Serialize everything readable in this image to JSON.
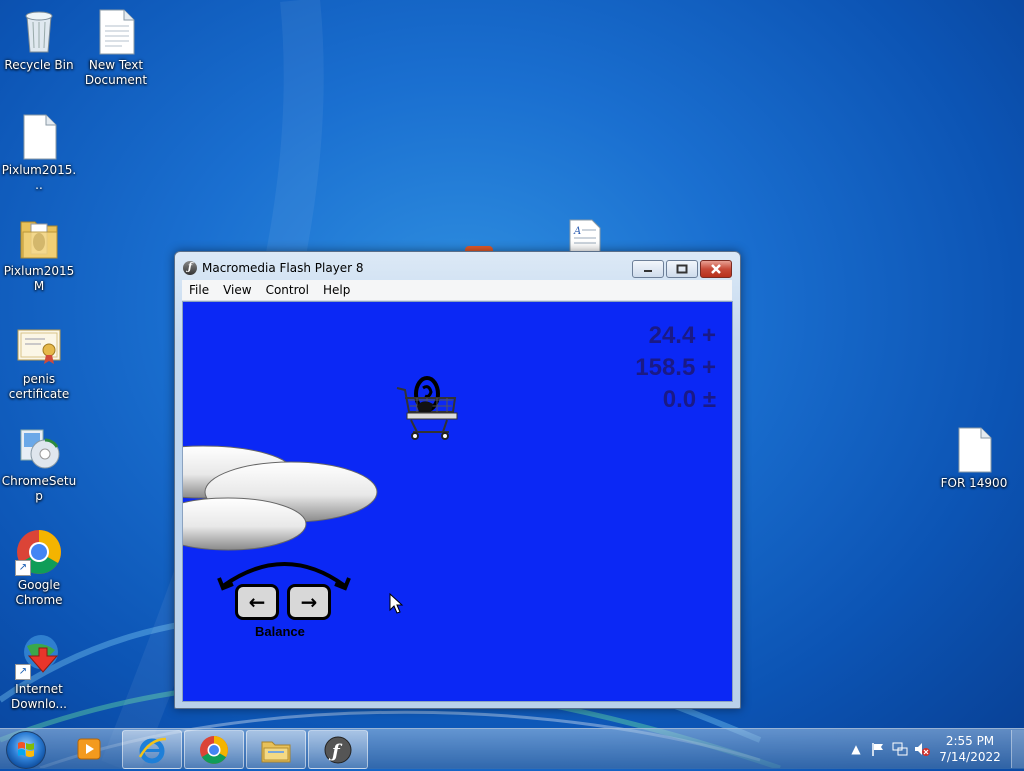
{
  "desktop": {
    "icons": [
      {
        "label": "Recycle Bin",
        "icon": "recycle-bin-icon"
      },
      {
        "label": "New Text Document",
        "icon": "text-document-icon"
      },
      {
        "label": "Pixlum2015...",
        "icon": "blank-file-icon"
      },
      {
        "label": "Pixlum2015M",
        "icon": "folder-icon"
      },
      {
        "label": "penis certificate",
        "icon": "certificate-icon"
      },
      {
        "label": "ChromeSetup",
        "icon": "installer-icon"
      },
      {
        "label": "Google Chrome",
        "icon": "chrome-icon"
      },
      {
        "label": "Internet Downlo...",
        "icon": "idm-icon"
      },
      {
        "label": "FOR 14900",
        "icon": "blank-file-icon"
      }
    ]
  },
  "window": {
    "title": "Macromedia Flash Player 8",
    "menu": [
      "File",
      "View",
      "Control",
      "Help"
    ],
    "buttons": {
      "minimize": "minimize",
      "maximize": "maximize",
      "close": "close"
    }
  },
  "game": {
    "stats": [
      "24.4",
      "158.5",
      "0.0"
    ],
    "balance_label": "Balance",
    "keys": {
      "left": "←",
      "right": "→"
    }
  },
  "taskbar": {
    "apps": [
      "windows-media-player-icon",
      "internet-explorer-icon",
      "chrome-icon",
      "file-explorer-icon",
      "flash-player-icon"
    ],
    "clock": {
      "time": "2:55 PM",
      "date": "7/14/2022"
    }
  },
  "colors": {
    "stage": "#0b28f5",
    "desktop": "#1a6fd0",
    "close_button": "#c74a38"
  }
}
